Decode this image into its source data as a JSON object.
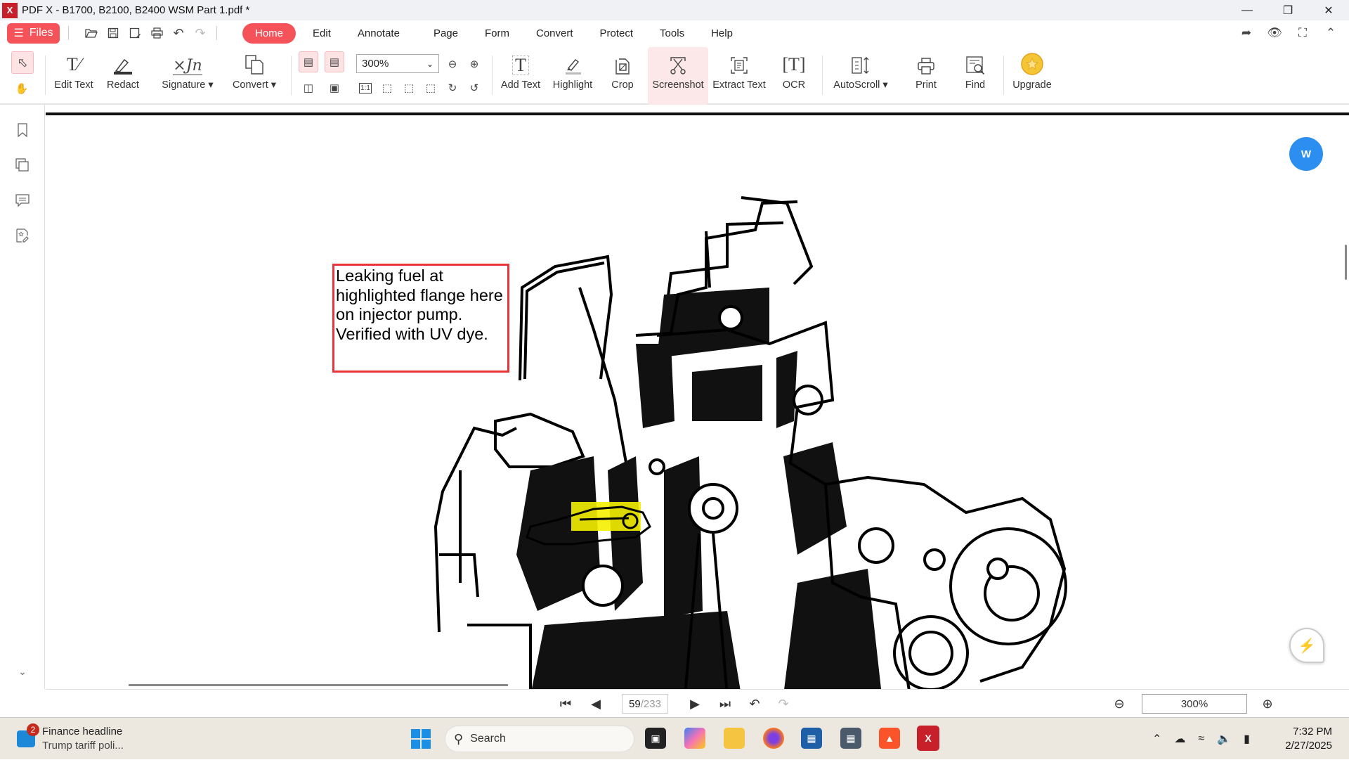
{
  "window": {
    "title": "PDF X - B1700, B2100, B2400 WSM Part 1.pdf *",
    "logo_text": "X",
    "controls": [
      "minimize",
      "restore",
      "close"
    ]
  },
  "menubar": {
    "files_label": "Files",
    "quick_access": [
      "open-folder-icon",
      "save-icon",
      "save-as-icon",
      "print-icon",
      "undo-icon",
      "redo-icon"
    ],
    "tabs": [
      "Home",
      "Edit",
      "Annotate",
      "Page",
      "Form",
      "Convert",
      "Protect",
      "Tools",
      "Help"
    ],
    "active_tab": "Home",
    "right_icons": [
      "share-icon",
      "read-mode-icon",
      "fullscreen-icon",
      "collapse-ribbon-icon"
    ]
  },
  "ribbon": {
    "edit_text": "Edit Text",
    "redact": "Redact",
    "signature": "Signature",
    "convert": "Convert",
    "zoom_value": "300%",
    "add_text": "Add Text",
    "highlight": "Highlight",
    "crop": "Crop",
    "screenshot": "Screenshot",
    "extract_text": "Extract Text",
    "ocr": "OCR",
    "autoscroll": "AutoScroll",
    "print": "Print",
    "find": "Find",
    "upgrade": "Upgrade",
    "actual_size_label": "1:1"
  },
  "sidebar": {
    "items": [
      "bookmarks",
      "pages",
      "comments",
      "signatures"
    ]
  },
  "document": {
    "note_text": "Leaking fuel at\nhighlighted flange here\non injector pump.\nVerified with UV dye.",
    "note_border_color": "#e8343a",
    "highlight_color": "#f5f000",
    "to_word_label": "W"
  },
  "bottombar": {
    "current_page": "59",
    "total_pages": "/233",
    "zoom": "300%"
  },
  "taskbar": {
    "widget_title": "Finance headline",
    "widget_subtitle": "Trump tariff poli...",
    "widget_badge": "2",
    "search_label": "Search",
    "time": "7:32 PM",
    "date": "2/27/2025",
    "apps": [
      "task-view",
      "copilot",
      "file-explorer",
      "firefox",
      "microsoft-store",
      "calculator",
      "brave",
      "pdf-x"
    ]
  }
}
